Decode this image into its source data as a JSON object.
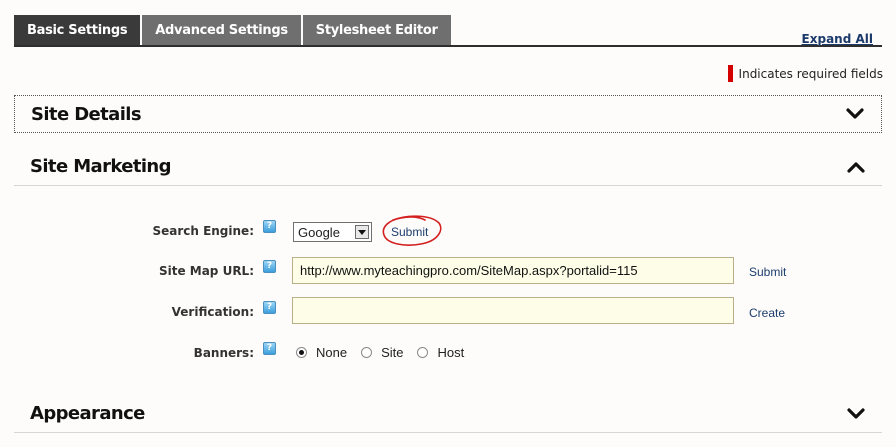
{
  "tabs": [
    {
      "label": "Basic Settings",
      "active": true
    },
    {
      "label": "Advanced Settings",
      "active": false
    },
    {
      "label": "Stylesheet Editor",
      "active": false
    }
  ],
  "expand_all": "Expand All",
  "required_note": "Indicates required fields",
  "colors": {
    "required": "#d40000",
    "link": "#1c3d6e",
    "tab_active": "#3a3a3a",
    "tab_inactive": "#6f6f6f"
  },
  "sections": {
    "site_details": {
      "title": "Site Details",
      "expanded": false,
      "icon": "chevron-down-icon"
    },
    "site_marketing": {
      "title": "Site Marketing",
      "expanded": true,
      "icon": "chevron-up-icon"
    },
    "appearance": {
      "title": "Appearance",
      "expanded": false,
      "icon": "chevron-down-icon"
    }
  },
  "marketing": {
    "search_engine": {
      "label": "Search Engine:",
      "value": "Google",
      "submit": "Submit"
    },
    "sitemap": {
      "label": "Site Map URL:",
      "value": "http://www.myteachingpro.com/SiteMap.aspx?portalid=115",
      "submit": "Submit"
    },
    "verification": {
      "label": "Verification:",
      "value": "",
      "create": "Create"
    },
    "banners": {
      "label": "Banners:",
      "options": [
        "None",
        "Site",
        "Host"
      ],
      "selected": "None"
    },
    "help_icon": "help-icon"
  }
}
